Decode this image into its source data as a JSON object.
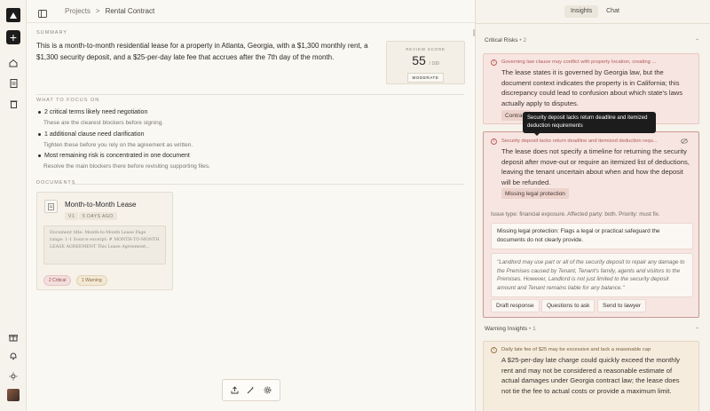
{
  "breadcrumb": {
    "root": "Projects",
    "separator": ">",
    "current": "Rental Contract"
  },
  "summary": {
    "label": "SUMMARY",
    "text": "This is a month-to-month residential lease for a property in Atlanta, Georgia, with a $1,300 monthly rent, a $1,300 security deposit, and a $25-per-day late fee that accrues after the 7th day of the month."
  },
  "score": {
    "label": "REVIEW SCORE",
    "value": "55",
    "max": "/ 100",
    "rating": "MODERATE"
  },
  "focus": {
    "label": "WHAT TO FOCUS ON",
    "items": [
      {
        "title": "2 critical terms likely need negotiation",
        "sub": "These are the clearest blockers before signing."
      },
      {
        "title": "1 additional clause need clarification",
        "sub": "Tighten these before you rely on the agreement as written."
      },
      {
        "title": "Most remaining risk is concentrated in one document",
        "sub": "Resolve the main blockers there before revisiting supporting files."
      }
    ]
  },
  "documents": {
    "label": "DOCUMENTS",
    "items": [
      {
        "title": "Month-to-Month Lease",
        "version": "V1",
        "age": "5 DAYS AGO",
        "preview": "Document title: Month-to-Month Lease Page range: 1-1 Source excerpt: # MONTH-TO-MONTH LEASE AGREEMENT This Lease Agreement...",
        "critical_badge": "2 Critical",
        "warning_badge": "1 Warning"
      }
    ]
  },
  "tabs": {
    "insights": "Insights",
    "chat": "Chat"
  },
  "critical": {
    "label": "Critical Risks",
    "count": "2",
    "cards": [
      {
        "title": "Governing law clause may conflict with property location, creating ...",
        "body": "The lease states it is governed by Georgia law, but the document context indicates the property is in California; this discrepancy could lead to confusion about which state's laws actually apply to disputes.",
        "chip": "Contract"
      },
      {
        "title": "Security deposit lacks return deadline and itemized deduction requ...",
        "body": "The lease does not specify a timeline for returning the security deposit after move-out or require an itemized list of deductions, leaving the tenant uncertain about when and how the deposit will be refunded.",
        "chip": "Missing legal protection",
        "meta": "Issue type: financial exposure. Affected party: both. Priority: must fix.",
        "explanation": "Missing legal protection: Flags a legal or practical safeguard the documents do not clearly provide.",
        "quote": "\"Landlord may use part or all of the security deposit to repair any damage to the Premises caused by Tenant, Tenant's family, agents and visitors to the Premises. However, Landlord is not just limited to the security deposit amount and Tenant remains liable for any balance.\"",
        "actions": [
          "Draft response",
          "Questions to ask",
          "Send to lawyer"
        ]
      }
    ]
  },
  "tooltip": "Security deposit lacks return deadline and itemized deduction requirements",
  "warnings": {
    "label": "Warning Insights",
    "count": "1",
    "cards": [
      {
        "title": "Daily late fee of $25 may be excessive and lack a reasonable cap",
        "body": "A $25-per-day late charge could quickly exceed the monthly rent and may not be considered a reasonable estimate of actual damages under Georgia contract law; the lease does not tie the fee to actual costs or provide a maximum limit."
      }
    ]
  },
  "icons": [
    "logo-icon",
    "plus-icon",
    "home-icon",
    "document-icon",
    "trash-icon",
    "gift-icon",
    "bell-icon",
    "sun-icon",
    "sidebar-toggle-icon",
    "upload-icon",
    "magic-wand-icon",
    "gear-icon",
    "alert-icon",
    "eye-off-icon"
  ]
}
